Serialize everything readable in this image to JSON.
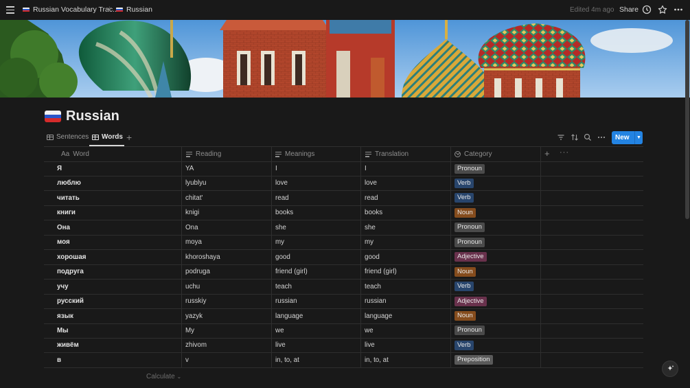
{
  "topbar": {
    "breadcrumb_parent": "Russian Vocabulary Trac...",
    "breadcrumb_separator": "/",
    "breadcrumb_current": "Russian",
    "edited": "Edited 4m ago",
    "share": "Share",
    "icons": [
      "menu-icon",
      "clock-icon",
      "star-icon",
      "more-icon"
    ]
  },
  "page": {
    "title": "Russian",
    "flag_colors": [
      "#f2f2f2",
      "#2a55c9",
      "#d52b2b"
    ]
  },
  "views": {
    "tabs": [
      {
        "label": "Sentences",
        "active": false
      },
      {
        "label": "Words",
        "active": true
      }
    ],
    "add_label": "+",
    "new_button": "New"
  },
  "table": {
    "columns": [
      {
        "label": "Word",
        "icon": "Aa"
      },
      {
        "label": "Reading",
        "icon": "text-icon"
      },
      {
        "label": "Meanings",
        "icon": "text-icon"
      },
      {
        "label": "Translation",
        "icon": "text-icon"
      },
      {
        "label": "Category",
        "icon": "select-icon"
      }
    ],
    "rows": [
      {
        "word": "Я",
        "reading": "YA",
        "meanings": "I",
        "translation": "I",
        "category": "Pronoun"
      },
      {
        "word": "люблю",
        "reading": "lyublyu",
        "meanings": "love",
        "translation": "love",
        "category": "Verb"
      },
      {
        "word": "читать",
        "reading": "chitat'",
        "meanings": "read",
        "translation": "read",
        "category": "Verb"
      },
      {
        "word": "книги",
        "reading": "knigi",
        "meanings": "books",
        "translation": "books",
        "category": "Noun"
      },
      {
        "word": "Она",
        "reading": "Ona",
        "meanings": "she",
        "translation": "she",
        "category": "Pronoun"
      },
      {
        "word": "моя",
        "reading": "moya",
        "meanings": "my",
        "translation": "my",
        "category": "Pronoun"
      },
      {
        "word": "хорошая",
        "reading": "khoroshaya",
        "meanings": "good",
        "translation": "good",
        "category": "Adjective"
      },
      {
        "word": "подруга",
        "reading": "podruga",
        "meanings": "friend (girl)",
        "translation": "friend (girl)",
        "category": "Noun"
      },
      {
        "word": "учу",
        "reading": "uchu",
        "meanings": "teach",
        "translation": "teach",
        "category": "Verb"
      },
      {
        "word": "русский",
        "reading": "russkiy",
        "meanings": "russian",
        "translation": "russian",
        "category": "Adjective"
      },
      {
        "word": "язык",
        "reading": "yazyk",
        "meanings": "language",
        "translation": "language",
        "category": "Noun"
      },
      {
        "word": "Мы",
        "reading": "My",
        "meanings": "we",
        "translation": "we",
        "category": "Pronoun"
      },
      {
        "word": "живём",
        "reading": "zhivom",
        "meanings": "live",
        "translation": "live",
        "category": "Verb"
      },
      {
        "word": "в",
        "reading": "v",
        "meanings": "in, to, at",
        "translation": "in, to, at",
        "category": "Preposition"
      }
    ],
    "category_colors": {
      "Pronoun": "#4a4a4a",
      "Verb": "#28456c",
      "Noun": "#854c1d",
      "Adjective": "#69314c",
      "Preposition": "#5a5a5a"
    },
    "calculate": "Calculate"
  }
}
